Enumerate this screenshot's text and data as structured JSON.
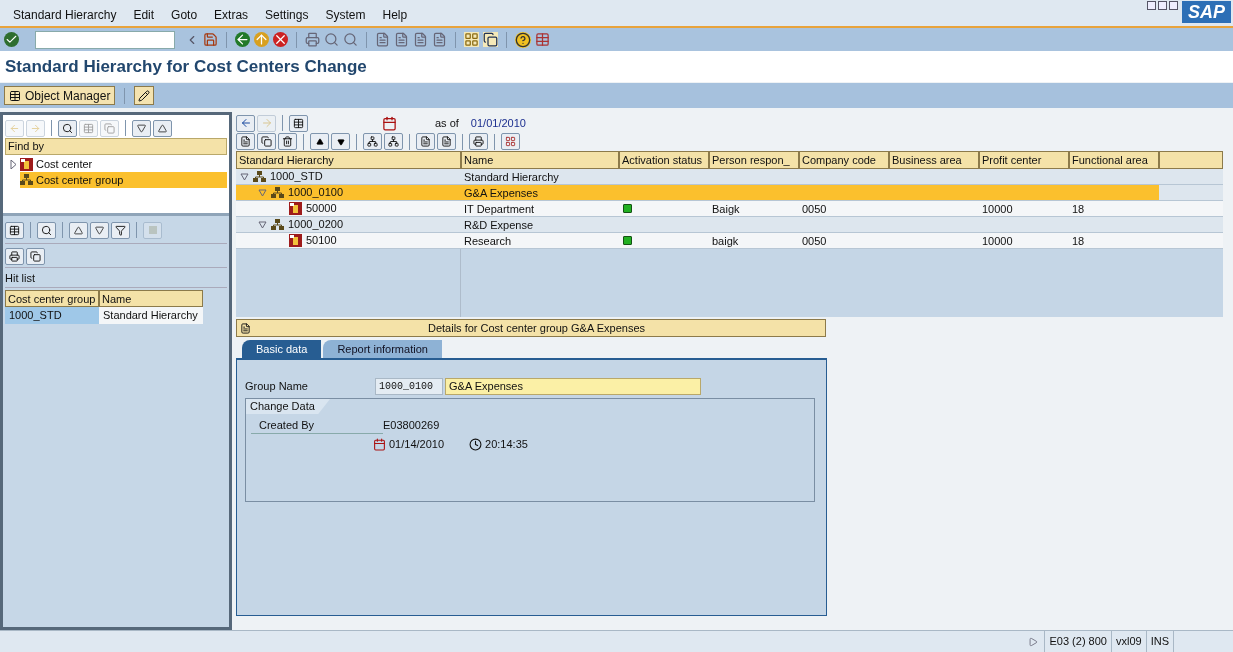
{
  "menu": [
    "Standard Hierarchy",
    "Edit",
    "Goto",
    "Extras",
    "Settings",
    "System",
    "Help"
  ],
  "logo": "SAP",
  "title": "Standard Hierarchy for Cost Centers Change",
  "object_manager": "Object Manager",
  "find_by": {
    "header": "Find by",
    "items": [
      {
        "label": "Cost center",
        "kind": "cost_center",
        "expandable": true,
        "selected": false
      },
      {
        "label": "Cost center group",
        "kind": "group",
        "expandable": false,
        "selected": true
      }
    ]
  },
  "hit_list": {
    "title": "Hit list",
    "columns": [
      "Cost center group",
      "Name"
    ],
    "rows": [
      {
        "cells": [
          "1000_STD",
          "Standard Hierarchy"
        ],
        "selected": true
      }
    ]
  },
  "as_of": {
    "label": "as of",
    "date": "01/01/2010"
  },
  "hierarchy": {
    "columns": [
      "Standard Hierarchy",
      "Name",
      "Activation status",
      "Person respon_",
      "Company code",
      "Business area",
      "Profit center",
      "Functional area"
    ],
    "rows": [
      {
        "node": "1000_STD",
        "kind": "group",
        "expanded": true,
        "selected": false,
        "name": "Standard Hierarchy",
        "children": [
          {
            "node": "1000_0100",
            "kind": "group",
            "expanded": true,
            "selected": true,
            "name": "G&A Expenses",
            "children": [
              {
                "node": "50000",
                "kind": "cost_center",
                "selected": false,
                "name": "IT Department",
                "active": true,
                "person": "Baigk",
                "company": "0050",
                "profit": "10000",
                "functional": "18"
              }
            ]
          },
          {
            "node": "1000_0200",
            "kind": "group",
            "expanded": true,
            "selected": false,
            "name": "R&D Expense",
            "children": [
              {
                "node": "50100",
                "kind": "cost_center",
                "selected": false,
                "name": "Research",
                "active": true,
                "person": "baigk",
                "company": "0050",
                "profit": "10000",
                "functional": "18"
              }
            ]
          }
        ]
      }
    ]
  },
  "details": {
    "title": "Details for Cost center group G&A Expenses",
    "tabs": [
      {
        "label": "Basic data",
        "selected": true
      },
      {
        "label": "Report information",
        "selected": false
      }
    ],
    "group_name_label": "Group Name",
    "group_code": "1000_0100",
    "group_text": "G&A Expenses",
    "change_data": {
      "title": "Change Data",
      "created_by_label": "Created By",
      "created_by": "E03800269",
      "date": "01/14/2010",
      "time": "20:14:35"
    }
  },
  "status_bar": [
    "E03 (2) 800",
    "vxl09",
    "INS"
  ]
}
